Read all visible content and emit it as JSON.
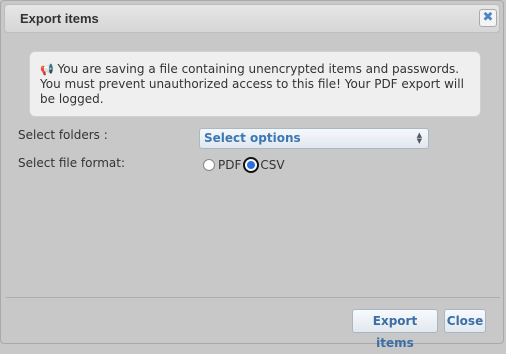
{
  "dialog": {
    "title": "Export items",
    "close_symbol": "✖"
  },
  "warning": {
    "icon": "megaphone-icon",
    "icon_glyph": "📢",
    "line1": "You are saving a file containing unencrypted items and passwords.",
    "line2": "You must prevent unauthorized access to this file! Your PDF export will",
    "line3": "be logged."
  },
  "form": {
    "folders_label": "Select folders :",
    "folders_value": "Select options",
    "format_label": "Select file format:",
    "format_options": [
      {
        "label": "PDF",
        "checked": false
      },
      {
        "label": "CSV",
        "checked": true
      }
    ]
  },
  "footer": {
    "export_label": "Export items",
    "close_label": "Close"
  },
  "colors": {
    "accent": "#3a78b6",
    "radio_selected": "#2a6fe0"
  }
}
